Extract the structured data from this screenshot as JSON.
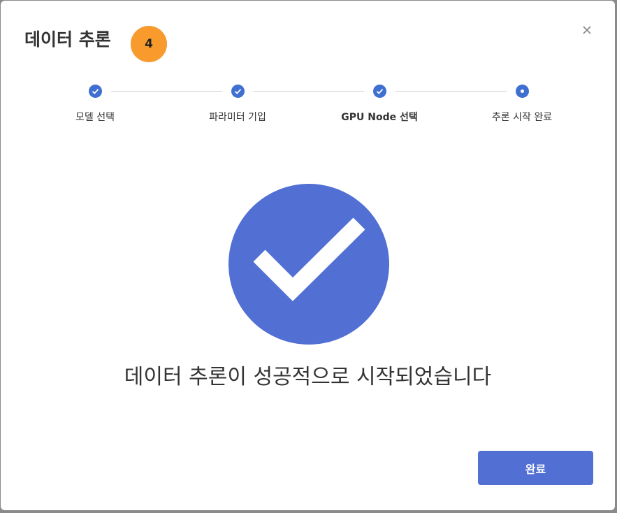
{
  "modal": {
    "title": "데이터 추론",
    "step_badge": "4"
  },
  "stepper": {
    "steps": [
      {
        "label": "모델 선택",
        "status": "done"
      },
      {
        "label": "파라미터 기입",
        "status": "done"
      },
      {
        "label": "GPU Node 선택",
        "status": "done"
      },
      {
        "label": "추론 시작 완료",
        "status": "current"
      }
    ]
  },
  "result": {
    "message": "데이터 추론이 성공적으로 시작되었습니다",
    "icon": "check-circle-icon"
  },
  "footer": {
    "done_label": "완료"
  },
  "colors": {
    "accent": "#526fd4",
    "step": "#3f6fd0",
    "badge": "#f99a2c"
  }
}
